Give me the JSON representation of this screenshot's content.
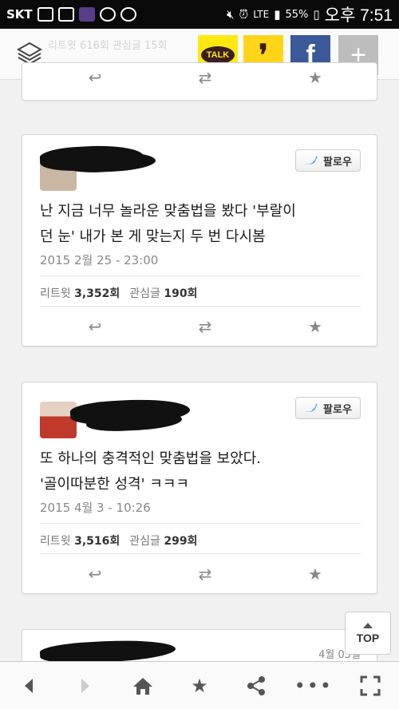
{
  "status_bar": {
    "carrier": "SKT",
    "network": "LTE",
    "battery": "55%",
    "time": "오후 7:51"
  },
  "top_bar": {
    "ghost_text": "리트윗 616회  관심글 15회",
    "share_buttons": [
      {
        "label": "TALK",
        "color": "#ffe812"
      },
      {
        "label": "❜",
        "color": "#ffd51a"
      },
      {
        "label": "f",
        "color": "#3b5998"
      },
      {
        "label": "+",
        "color": "#bdbdbd"
      }
    ]
  },
  "tweets": [
    {
      "follow_label": "팔로우",
      "text_line1": "난 지금 너무 놀라운 맞춤법을 봤다 '부랄이",
      "text_line2": "던 눈' 내가 본 게 맞는지 두 번 다시봄",
      "date": "2015 2월 25 - 23:00",
      "retweet_label": "리트윗",
      "retweet_count": "3,352회",
      "fav_label": "관심글",
      "fav_count": "190회"
    },
    {
      "follow_label": "팔로우",
      "text_line1": "또 하나의 충격적인 맞춤법을 보았다.",
      "text_line2": "'골이따분한 성격' ㅋㅋㅋ",
      "date": "2015 4월 3 - 10:26",
      "retweet_label": "리트윗",
      "retweet_count": "3,516회",
      "fav_label": "관심글",
      "fav_count": "299회"
    }
  ],
  "partial_tweet": {
    "date": "4월 03일"
  },
  "top_button": {
    "label": "TOP"
  },
  "bottom_nav": {
    "back_icon": "chevron-left-icon",
    "forward_icon": "chevron-right-icon",
    "home_icon": "home-icon",
    "bookmark_icon": "star-icon",
    "share_icon": "share-icon",
    "more_icon": "more-icon",
    "fullscreen_icon": "fullscreen-icon"
  }
}
